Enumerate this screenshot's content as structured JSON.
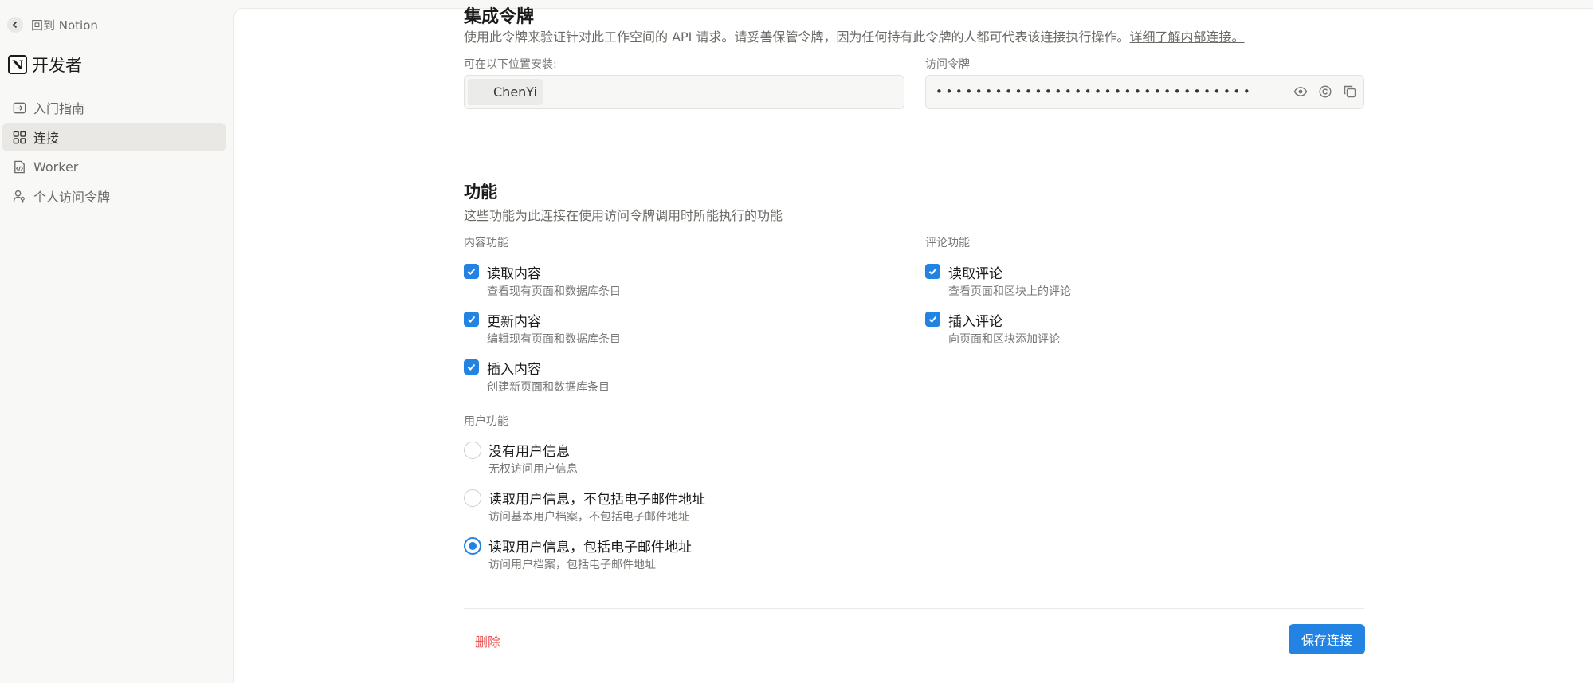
{
  "sidebar": {
    "back_label": "回到 Notion",
    "brand": {
      "logo_letter": "N",
      "title": "开发者"
    },
    "items": [
      {
        "label": "入门指南",
        "icon": "arrow-in-box-icon",
        "active": false
      },
      {
        "label": "连接",
        "icon": "grid-icon",
        "active": true
      },
      {
        "label": "Worker",
        "icon": "code-file-icon",
        "active": false
      },
      {
        "label": "个人访问令牌",
        "icon": "user-key-icon",
        "active": false
      }
    ]
  },
  "token_section": {
    "title": "集成令牌",
    "description": "使用此令牌来验证针对此工作空间的 API 请求。请妥善保管令牌，因为任何持有此令牌的人都可代表该连接执行操作。",
    "learn_more_link": "详细了解内部连接。",
    "install_label": "可在以下位置安装:",
    "install_workspace": "ChenYi",
    "token_label": "访问令牌",
    "token_masked": "••••••••••••••••••••••••••••••••"
  },
  "capabilities": {
    "title": "功能",
    "description": "这些功能为此连接在使用访问令牌调用时所能执行的功能",
    "content": {
      "label": "内容功能",
      "options": [
        {
          "title": "读取内容",
          "subtitle": "查看现有页面和数据库条目",
          "checked": true
        },
        {
          "title": "更新内容",
          "subtitle": "编辑现有页面和数据库条目",
          "checked": true
        },
        {
          "title": "插入内容",
          "subtitle": "创建新页面和数据库条目",
          "checked": true
        }
      ]
    },
    "comments": {
      "label": "评论功能",
      "options": [
        {
          "title": "读取评论",
          "subtitle": "查看页面和区块上的评论",
          "checked": true
        },
        {
          "title": "插入评论",
          "subtitle": "向页面和区块添加评论",
          "checked": true
        }
      ]
    },
    "user": {
      "label": "用户功能",
      "options": [
        {
          "title": "没有用户信息",
          "subtitle": "无权访问用户信息",
          "selected": false
        },
        {
          "title": "读取用户信息，不包括电子邮件地址",
          "subtitle": "访问基本用户档案，不包括电子邮件地址",
          "selected": false
        },
        {
          "title": "读取用户信息，包括电子邮件地址",
          "subtitle": "访问用户档案，包括电子邮件地址",
          "selected": true
        }
      ]
    }
  },
  "footer": {
    "delete_label": "删除",
    "save_label": "保存连接"
  },
  "colors": {
    "accent": "#2383e2",
    "danger": "#eb5757"
  }
}
